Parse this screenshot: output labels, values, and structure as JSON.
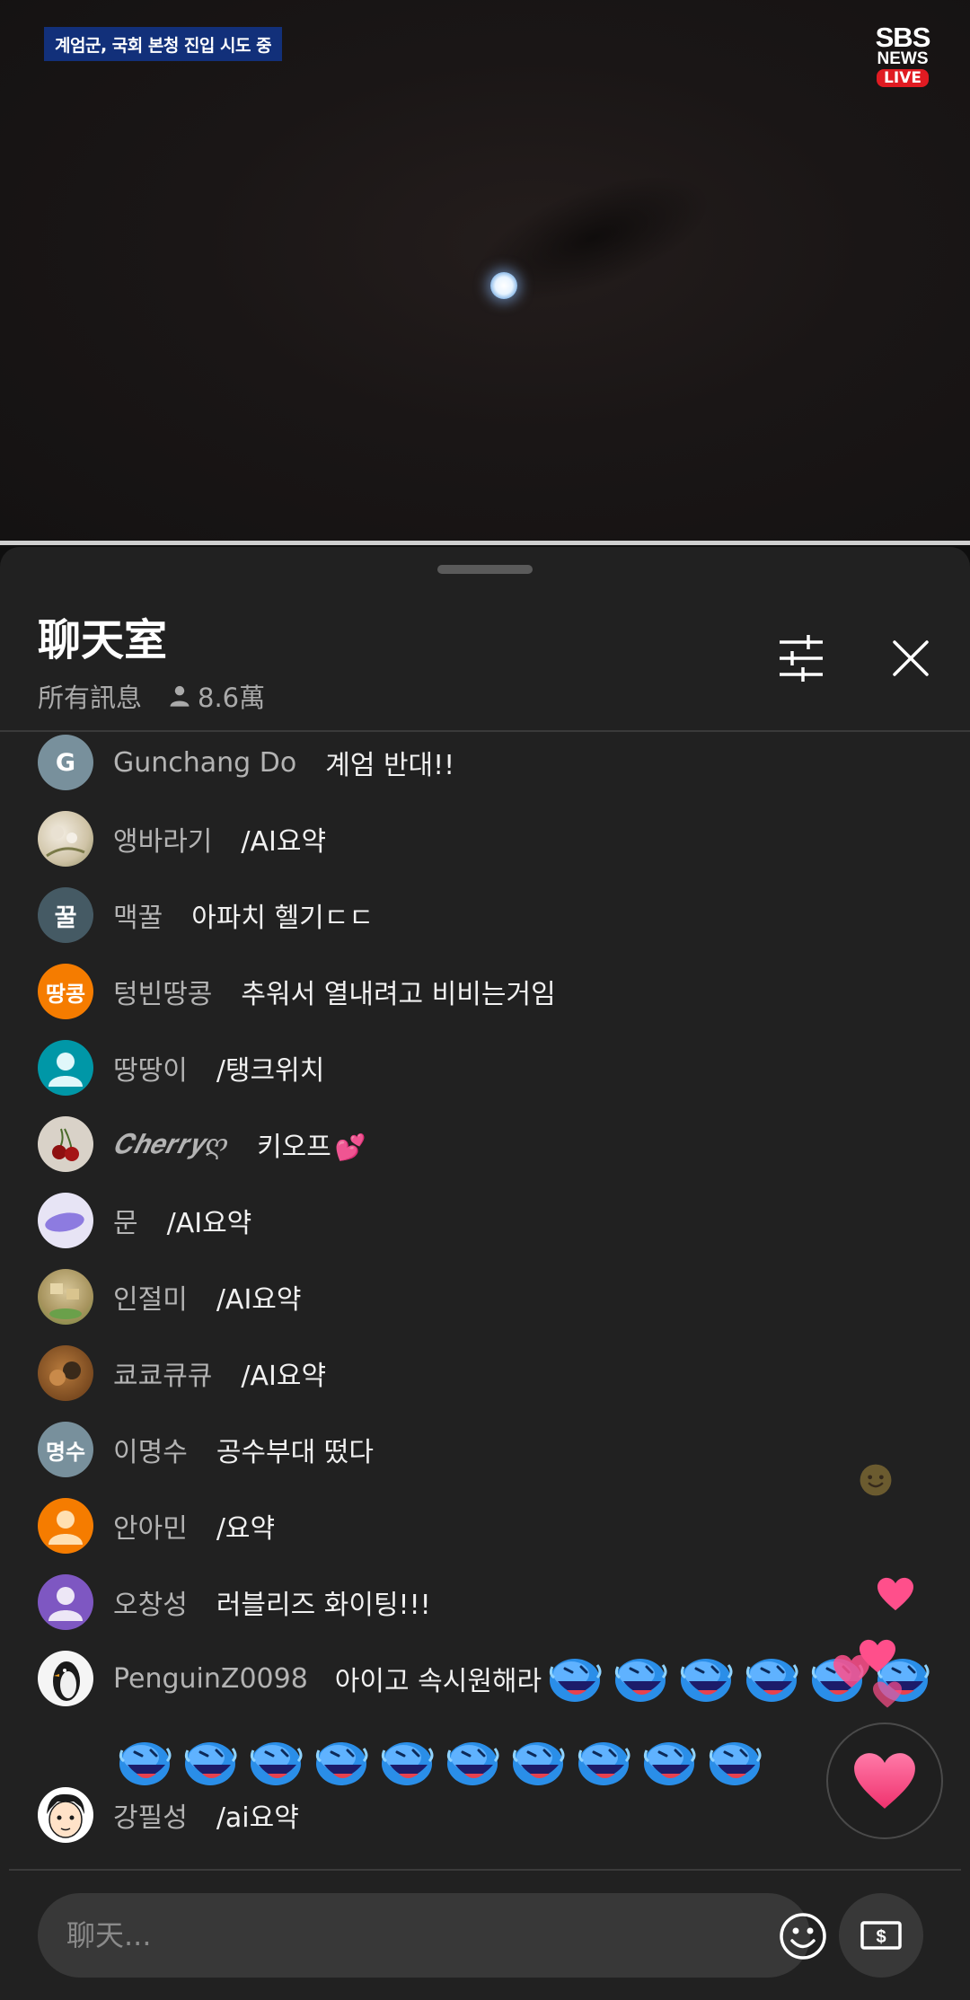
{
  "video": {
    "caption": "계엄군, 국회 본청 진입 시도 중",
    "logo": {
      "line1": "SBS",
      "line2": "NEWS",
      "badge": "LIVE"
    }
  },
  "chat": {
    "title": "聊天室",
    "filter_label": "所有訊息",
    "viewer_count": "8.6萬",
    "input_placeholder": "聊天...",
    "messages": [
      {
        "author": "Gunchang Do",
        "text": "계엄 반대!!",
        "avatar_letter": "G",
        "avatar_color": "#78909c"
      },
      {
        "author": "앵바라기",
        "text": "/AI요약",
        "avatar_type": "photo-flowers"
      },
      {
        "author": "맥꿀",
        "text": "아파치 헬기ㄷㄷ",
        "avatar_letter": "꿀",
        "avatar_color": "#455a64"
      },
      {
        "author": "텅빈땅콩",
        "text": "추워서 열내려고 비비는거임",
        "avatar_letter": "땅콩",
        "avatar_color": "#f57c00"
      },
      {
        "author": "땅땅이",
        "text": "/탱크위치",
        "avatar_type": "default-person",
        "avatar_color": "#0097a7"
      },
      {
        "author": "𝑪𝒉𝒆𝒓𝒓𝒚ღ",
        "text": "키오프",
        "emoji": "💕",
        "avatar_type": "photo-cherry"
      },
      {
        "author": "문",
        "text": "/AI요약",
        "avatar_type": "photo-purple"
      },
      {
        "author": "인절미",
        "text": "/AI요약",
        "avatar_type": "photo-food"
      },
      {
        "author": "쿄쿄큐큐",
        "text": "/AI요약",
        "avatar_type": "photo-monkey"
      },
      {
        "author": "이명수",
        "text": "공수부대 떴다",
        "avatar_letter": "명수",
        "avatar_color": "#78909c"
      },
      {
        "author": "안아민",
        "text": "/요약",
        "avatar_type": "default-person",
        "avatar_color": "#f57c00"
      },
      {
        "author": "오창성",
        "text": "러블리즈 화이팅!!!",
        "avatar_type": "default-person",
        "avatar_color": "#7e57c2"
      },
      {
        "author": "PenguinZ0098",
        "text": "아이고 속시원해라",
        "avatar_type": "photo-penguin",
        "emoji_count_line1": 6,
        "emoji_count_line2": 10
      },
      {
        "author": "강필성",
        "text": "/ai요약",
        "avatar_type": "cartoon-face"
      }
    ]
  },
  "colors": {
    "accent_heart": "#ff4f8b",
    "panel_bg": "#212121",
    "caption_bg": "#12307a",
    "live_badge": "#e01b22"
  },
  "icons": [
    "filter-icon",
    "close-icon",
    "person-icon",
    "smiley-icon",
    "money-icon",
    "heart-icon"
  ]
}
